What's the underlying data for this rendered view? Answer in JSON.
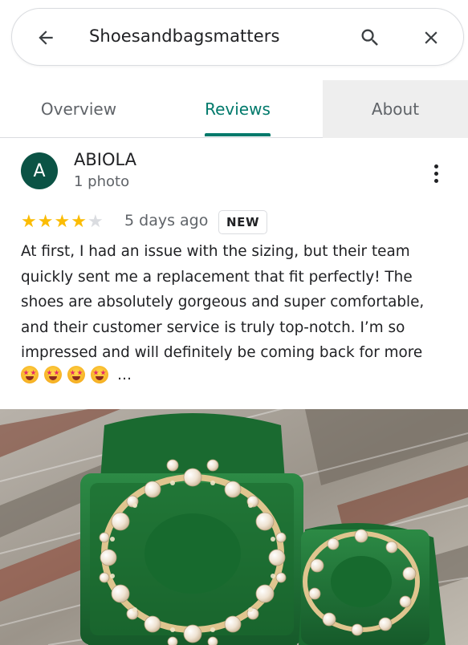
{
  "search": {
    "query": "Shoesandbagsmatters"
  },
  "icons": {
    "back": "arrow-back-icon",
    "search": "search-icon",
    "close": "close-icon",
    "more": "more-vert-icon"
  },
  "tabs": [
    {
      "label": "Overview",
      "active": false
    },
    {
      "label": "Reviews",
      "active": true
    },
    {
      "label": "About",
      "active": false
    }
  ],
  "review": {
    "avatar_letter": "A",
    "name": "ABIOLA",
    "meta": "1 photo",
    "rating": 4,
    "max_rating": 5,
    "date": "5 days ago",
    "badge": "NEW",
    "text": "At first, I had an issue with the sizing, but their team quickly sent me a replacement that fit perfectly! The shoes are absolutely gorgeous and super comfortable, and their customer service is truly top-notch. I’m so impressed and will definitely be coming back for more",
    "emoji_count": 4,
    "truncation": "…"
  },
  "colors": {
    "accent": "#00796b",
    "star": "#fbbc04",
    "avatar_bg": "#0b5345",
    "shoe": "#1f6b34"
  }
}
